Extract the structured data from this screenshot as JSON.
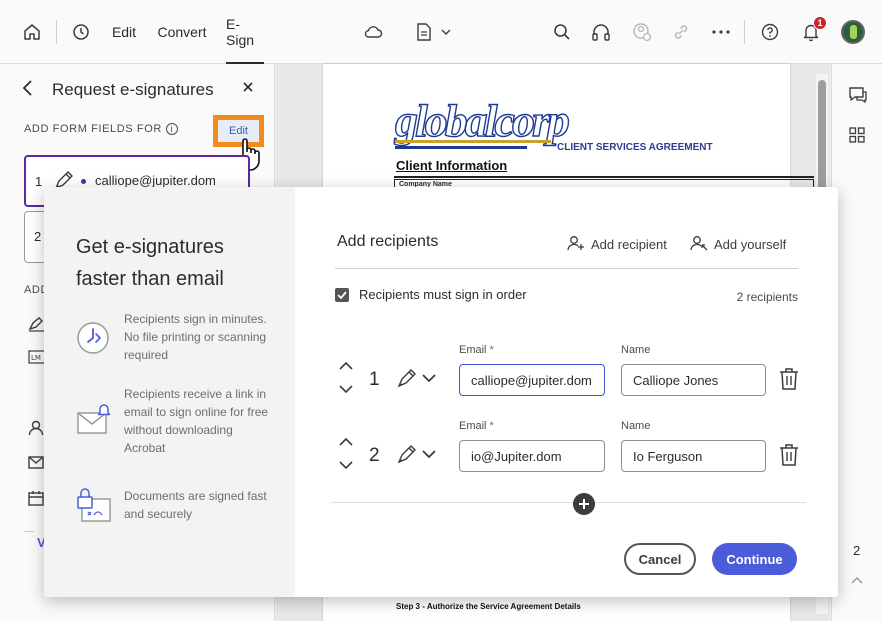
{
  "toolbar": {
    "tabs": [
      {
        "label": "Edit"
      },
      {
        "label": "Convert"
      },
      {
        "label": "E-Sign"
      }
    ],
    "active_tab": "E-Sign",
    "notification_count": "1",
    "icons": [
      "home-icon",
      "history-icon",
      "cloud-icon",
      "document-icon",
      "search-icon",
      "headphones-icon",
      "user-sync-icon",
      "link-icon",
      "more-icon",
      "help-icon",
      "bell-icon",
      "avatar"
    ]
  },
  "left_panel": {
    "title": "Request e-signatures",
    "add_fields_for_label": "ADD FORM FIELDS FOR",
    "edit_link": "Edit",
    "recipients": [
      {
        "number": "1",
        "email": "calliope@jupiter.dom",
        "active": true
      },
      {
        "number": "2",
        "email": "",
        "active": false
      }
    ],
    "add_section_label": "ADD",
    "link_initial": "V"
  },
  "document": {
    "logo_text": "globalcorp",
    "agreement_title": "CLIENT SERVICES AGREEMENT",
    "section_heading": "Client Information",
    "company_name_label": "Company Name",
    "step3_text": "Step 3 - Authorize the Service Agreement Details"
  },
  "right_rail": {
    "page_number": "2"
  },
  "modal": {
    "heading": "Get e-signatures faster than email",
    "features": [
      {
        "icon": "clock-icon",
        "text": "Recipients sign in minutes. No file printing or scanning required"
      },
      {
        "icon": "email-notification-icon",
        "text": "Recipients receive a link in email to sign online for free without downloading Acrobat"
      },
      {
        "icon": "secure-document-icon",
        "text": "Documents are signed fast and securely"
      }
    ],
    "title": "Add recipients",
    "add_recipient_label": "Add recipient",
    "add_yourself_label": "Add yourself",
    "sign_in_order_label": "Recipients must sign in order",
    "sign_in_order_checked": true,
    "recipient_count": "2 recipients",
    "email_label": "Email",
    "required_mark": "*",
    "name_label": "Name",
    "rows": [
      {
        "number": "1",
        "email": "calliope@jupiter.dom",
        "name": "Calliope Jones"
      },
      {
        "number": "2",
        "email": "io@Jupiter.dom",
        "name": "Io Ferguson"
      }
    ],
    "cancel_label": "Cancel",
    "continue_label": "Continue"
  },
  "colors": {
    "accent": "#4b5cdb",
    "highlight": "#f08c19",
    "active_recipient": "#5a2ba0",
    "badge": "#c9252d"
  }
}
